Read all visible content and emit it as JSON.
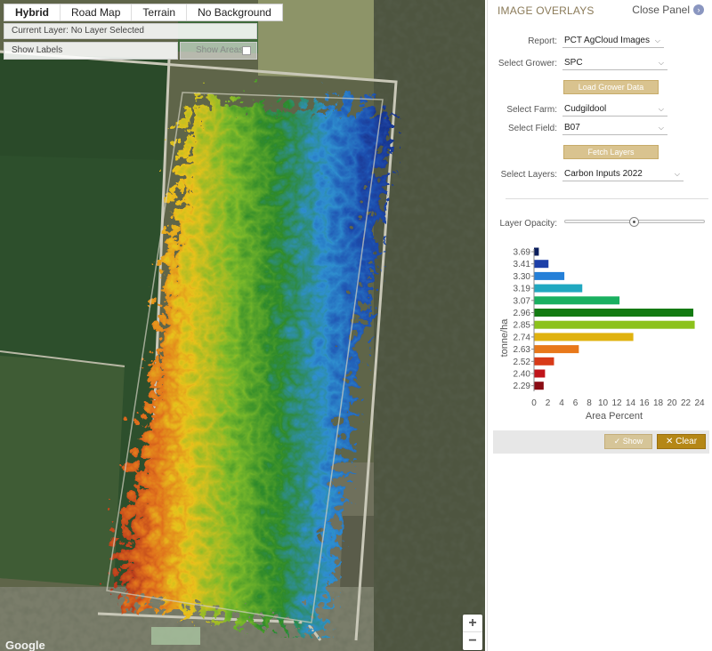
{
  "map": {
    "tabs": [
      {
        "label": "Hybrid",
        "active": true
      },
      {
        "label": "Road Map",
        "active": false
      },
      {
        "label": "Terrain",
        "active": false
      },
      {
        "label": "No Background",
        "active": false
      }
    ],
    "current_layer": "Current Layer: No Layer Selected",
    "show_labels": "Show Labels",
    "show_areas": "Show Areas",
    "zoom_in": "+",
    "zoom_out": "−",
    "attribution": "Google"
  },
  "panel": {
    "title": "IMAGE OVERLAYS",
    "close_label": "Close Panel",
    "close_icon": "chevron-right-circle-icon",
    "report": {
      "label": "Report:",
      "value": "PCT AgCloud Images"
    },
    "grower": {
      "label": "Select Grower:",
      "value": "SPC"
    },
    "load_grower_button": "Load Grower Data",
    "farm": {
      "label": "Select Farm:",
      "value": "Cudgildool"
    },
    "field": {
      "label": "Select Field:",
      "value": "B07"
    },
    "fetch_layers_button": "Fetch Layers",
    "layers": {
      "label": "Select Layers:",
      "value": "Carbon Inputs 2022"
    },
    "opacity_label": "Layer Opacity:",
    "opacity_value": 0.5,
    "show_button": "Show",
    "clear_button": "Clear"
  },
  "chart_data": {
    "type": "bar",
    "orientation": "horizontal",
    "ylabel": "tonne/ha",
    "xlabel": "Area Percent",
    "xlim": [
      0,
      24
    ],
    "xticks": [
      0,
      2,
      4,
      6,
      8,
      10,
      12,
      14,
      16,
      18,
      20,
      22,
      24
    ],
    "categories": [
      "3.69",
      "3.41",
      "3.30",
      "3.19",
      "3.07",
      "2.96",
      "2.85",
      "2.74",
      "2.63",
      "2.52",
      "2.40",
      "2.29"
    ],
    "values": [
      0.7,
      2.1,
      4.4,
      7.0,
      12.4,
      23.1,
      23.3,
      14.4,
      6.5,
      2.9,
      1.6,
      1.4
    ],
    "colors": [
      "#0a1d5c",
      "#1c3fa8",
      "#2580d8",
      "#20a8c0",
      "#19b060",
      "#137a12",
      "#8cc21c",
      "#e0b20f",
      "#e8781a",
      "#d83a18",
      "#c0141a",
      "#8a0c14"
    ],
    "legend": "none",
    "grid": false
  },
  "colors": {
    "accent": "#b58716",
    "button": "#d9c38f",
    "header_text": "#8a7a58"
  }
}
